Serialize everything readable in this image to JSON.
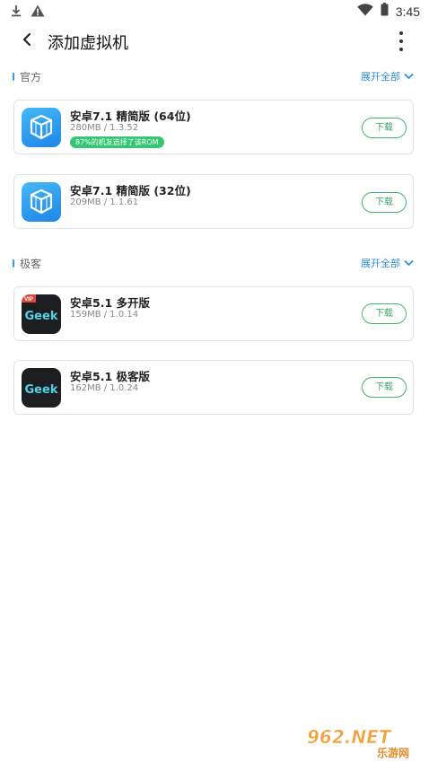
{
  "status_bar": {
    "time": "3:45",
    "icons": [
      "download-icon",
      "warning-icon",
      "wifi-icon",
      "battery-icon"
    ]
  },
  "header": {
    "title": "添加虚拟机",
    "back_icon": "back-arrow-icon",
    "more_icon": "more-vertical-icon"
  },
  "sections": [
    {
      "title": "官方",
      "expand_label": "展开全部",
      "items": [
        {
          "name": "安卓7.1 精简版 (64位)",
          "meta": "280MB / 1.3.52",
          "tag": "87%的机友选择了该ROM",
          "button": "下载",
          "icon": "vmos-cube-icon"
        },
        {
          "name": "安卓7.1 精简版 (32位)",
          "meta": "209MB / 1.1.61",
          "button": "下载",
          "icon": "vmos-cube-icon"
        }
      ]
    },
    {
      "title": "极客",
      "expand_label": "展开全部",
      "items": [
        {
          "name": "安卓5.1 多开版",
          "meta": "159MB / 1.0.14",
          "button": "下载",
          "icon": "geek-vip-icon",
          "badge": "VIP",
          "icon_text": "Geek"
        },
        {
          "name": "安卓5.1 极客版",
          "meta": "162MB / 1.0.24",
          "button": "下载",
          "icon": "geek-icon",
          "icon_text": "Geek"
        }
      ]
    }
  ],
  "watermark": {
    "brand": "962.NET",
    "sub": "乐游网"
  },
  "colors": {
    "accent_blue": "#2f9de8",
    "download_green": "#3fb86d",
    "tag_green": "#34c675"
  }
}
